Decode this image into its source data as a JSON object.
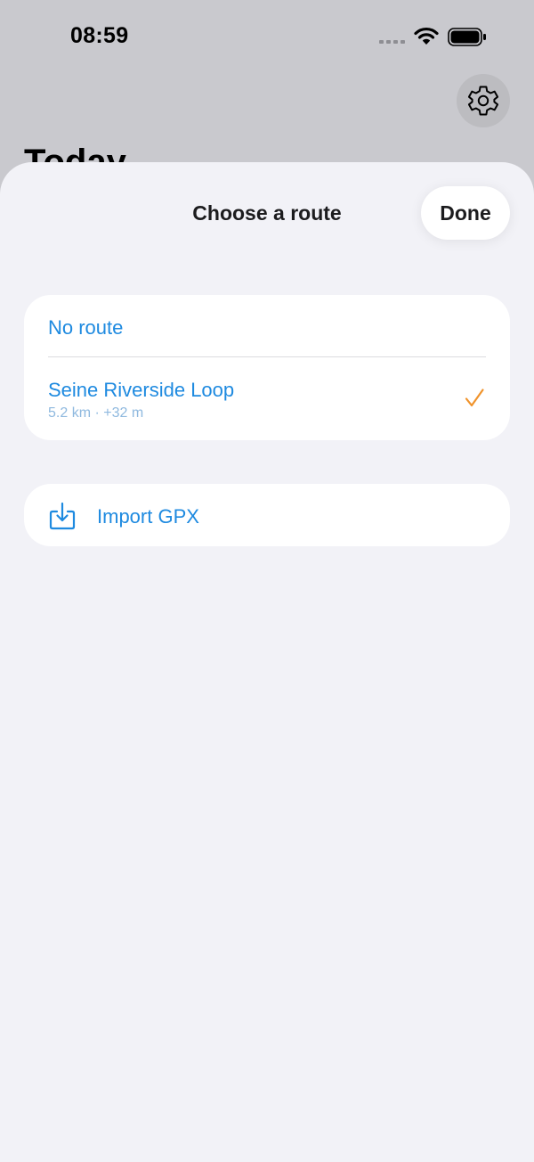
{
  "status_bar": {
    "time": "08:59"
  },
  "background": {
    "title": "Today",
    "icons": [
      "gear-icon"
    ]
  },
  "sheet": {
    "title": "Choose a route",
    "done_label": "Done",
    "routes": [
      {
        "label": "No route"
      },
      {
        "label": "Seine Riverside Loop",
        "subtitle": "5.2 km · +32 m",
        "selected": true
      }
    ],
    "import": {
      "label": "Import GPX",
      "icon": "import-icon"
    }
  },
  "colors": {
    "accent": "#1e8ae0",
    "checkmark": "#f0932b",
    "sheet_background": "#f2f2f7",
    "dimmed_background": "#c9c9ce"
  }
}
